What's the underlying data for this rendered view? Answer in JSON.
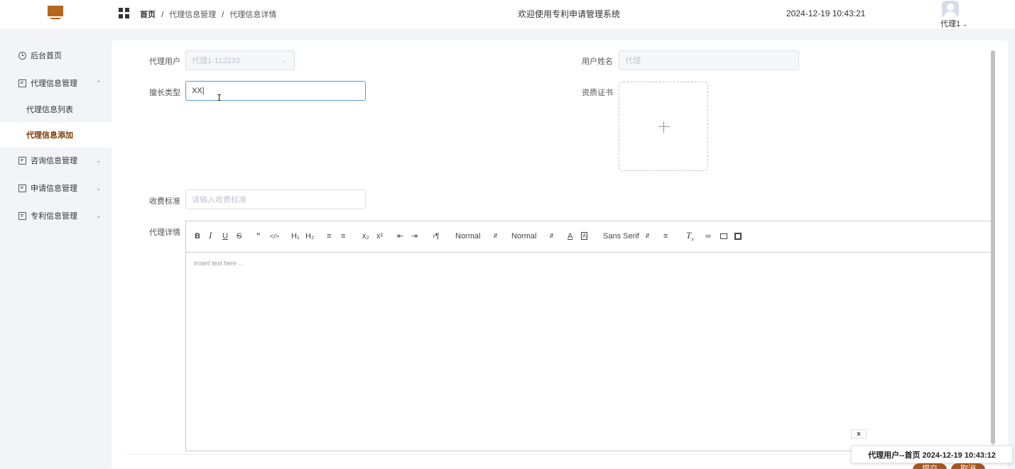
{
  "header": {
    "breadcrumb_home": "首页",
    "breadcrumb_sep": "/",
    "breadcrumb_section": "代理信息管理",
    "breadcrumb_page": "代理信息详情",
    "welcome": "欢迎使用专利申请管理系统",
    "datetime": "2024-12-19 10:43:21",
    "user": "代理1"
  },
  "sidebar": {
    "items": [
      {
        "label": "后台首页",
        "icon": "clock-icon"
      },
      {
        "label": "代理信息管理",
        "icon": "card-icon",
        "expanded": true
      },
      {
        "label": "代理信息列表"
      },
      {
        "label": "代理信息添加",
        "active": true
      },
      {
        "label": "咨询信息管理",
        "icon": "card-icon"
      },
      {
        "label": "申请信息管理",
        "icon": "card-icon"
      },
      {
        "label": "专利信息管理",
        "icon": "card-icon"
      }
    ]
  },
  "form": {
    "agent_user_label": "代理用户",
    "agent_user_value": "代理1-112233",
    "user_name_label": "用户姓名",
    "user_name_value": "代理",
    "specialty_label": "擅长类型",
    "specialty_value": "XX",
    "certificate_label": "资质证书",
    "fee_label": "收费标准",
    "fee_placeholder": "请输入收费标准",
    "detail_label": "代理详情"
  },
  "editor": {
    "header_picker": "Normal",
    "size_picker": "Normal",
    "font_picker": "Sans Serif",
    "placeholder": "Insert text here ...",
    "accent_color": "#5b9bd5"
  },
  "notification": {
    "close": "x",
    "text": "代理用户--首页 2024-12-19 10:43:12"
  },
  "buttons": {
    "submit": "提交",
    "cancel": "取消"
  },
  "theme": {
    "brand": "#b8651f",
    "active_text": "#7a3a06"
  }
}
